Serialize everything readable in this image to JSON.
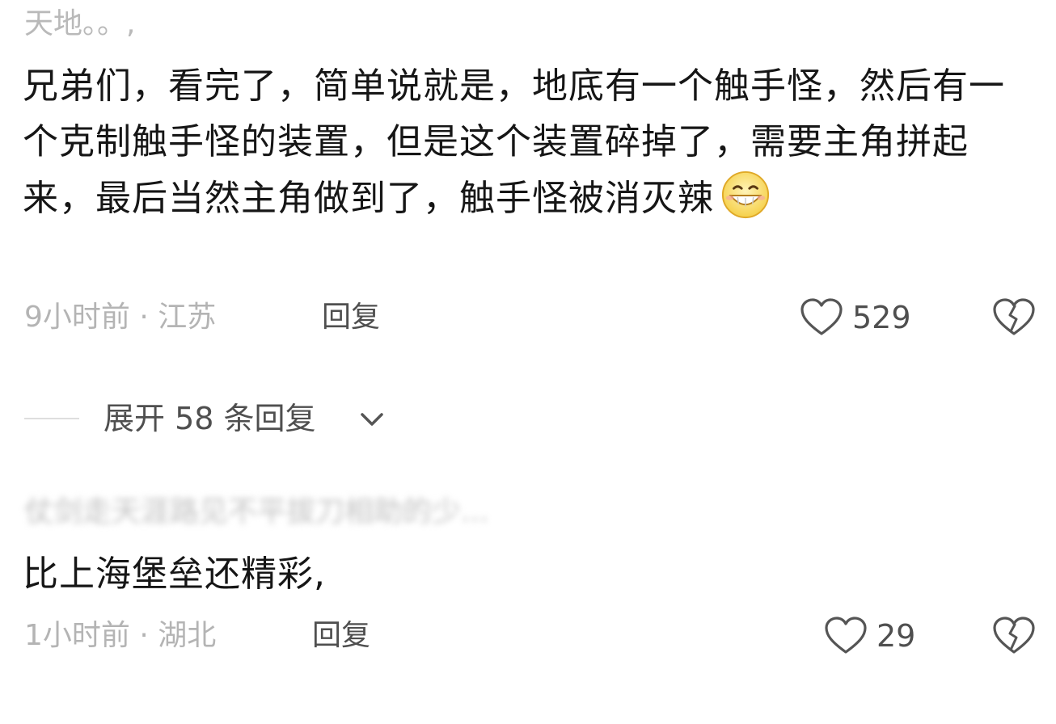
{
  "comments": [
    {
      "username": "天地。。,",
      "text": "兄弟们，看完了，简单说就是，地底有一个触手怪，然后有一个克制触手怪的装置，但是这个装置碎掉了，需要主角拼起来，最后当然主角做到了，触手怪被消灭辣",
      "emoji": "grinning-face-emoji",
      "time_location": "9小时前 · 江苏",
      "reply_label": "回复",
      "like_count": "529"
    },
    {
      "username": "仗剑走天涯路见不平拔刀相助的少... ",
      "text": "比上海堡垒还精彩,",
      "time_location": "1小时前 · 湖北",
      "reply_label": "回复",
      "like_count": "29"
    }
  ],
  "expand_replies": {
    "label": "展开 58 条回复"
  },
  "colors": {
    "text_primary": "#161616",
    "text_secondary": "#b4b4b4",
    "text_action": "#4f4f4f",
    "icon_stroke": "#555555",
    "background": "#ffffff"
  },
  "icons": {
    "like": "heart-outline-icon",
    "dislike": "broken-heart-icon",
    "expand": "chevron-down-icon"
  }
}
